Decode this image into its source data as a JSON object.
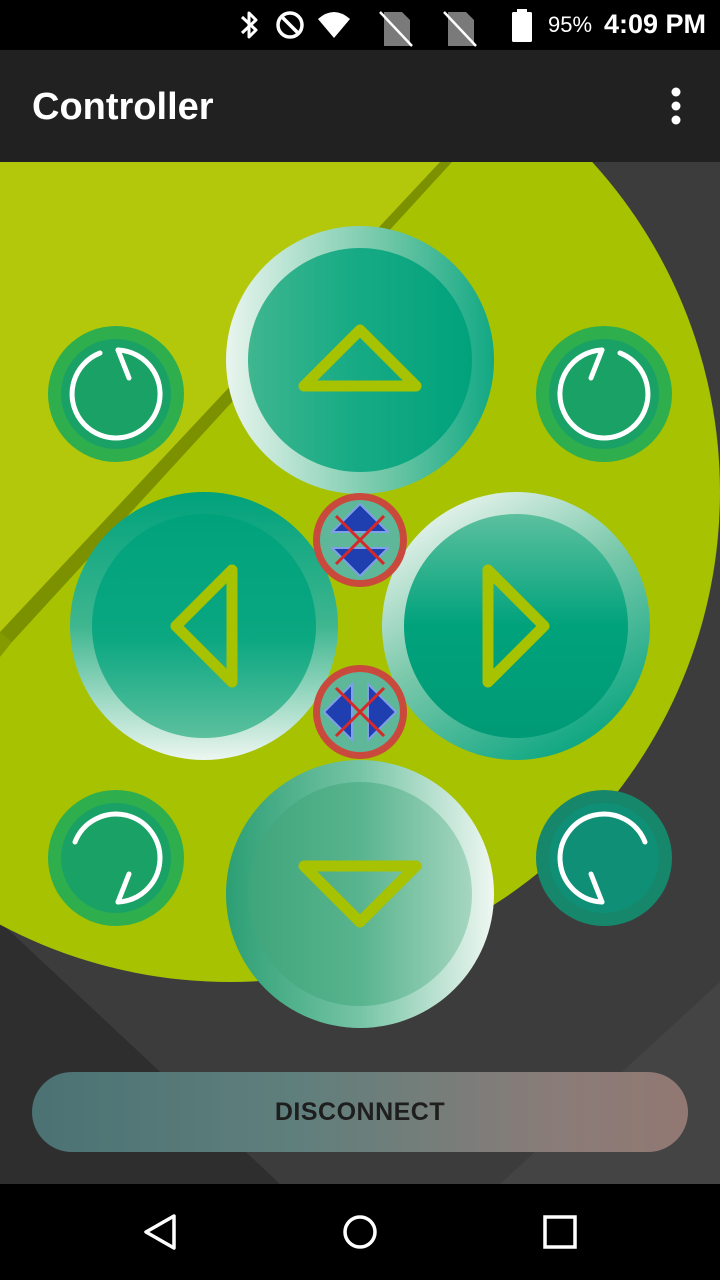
{
  "status_bar": {
    "battery_percent": "95%",
    "time": "4:09 PM",
    "icons": [
      "bluetooth-icon",
      "do-not-disturb-icon",
      "wifi-icon",
      "no-sim-icon",
      "no-sim-icon",
      "battery-icon"
    ]
  },
  "app_bar": {
    "title": "Controller",
    "menu_icon": "more-vert-icon"
  },
  "controls": {
    "up": "arrow-up-icon",
    "down": "arrow-down-icon",
    "left": "arrow-left-icon",
    "right": "arrow-right-icon",
    "rotate_buttons": [
      "rotate-ccw-icon",
      "rotate-cw-icon",
      "rotate-cw-icon",
      "rotate-ccw-icon"
    ],
    "toggle_vertical": "vertical-disabled-icon",
    "toggle_horizontal": "horizontal-disabled-icon"
  },
  "colors": {
    "accent_green": "#00a884",
    "lime": "#a8c400",
    "disabled_red": "#cc3333",
    "app_bar": "#212121"
  },
  "actions": {
    "disconnect_label": "DISCONNECT"
  },
  "nav_bar": {
    "back": "back-icon",
    "home": "home-icon",
    "recents": "recents-icon"
  }
}
